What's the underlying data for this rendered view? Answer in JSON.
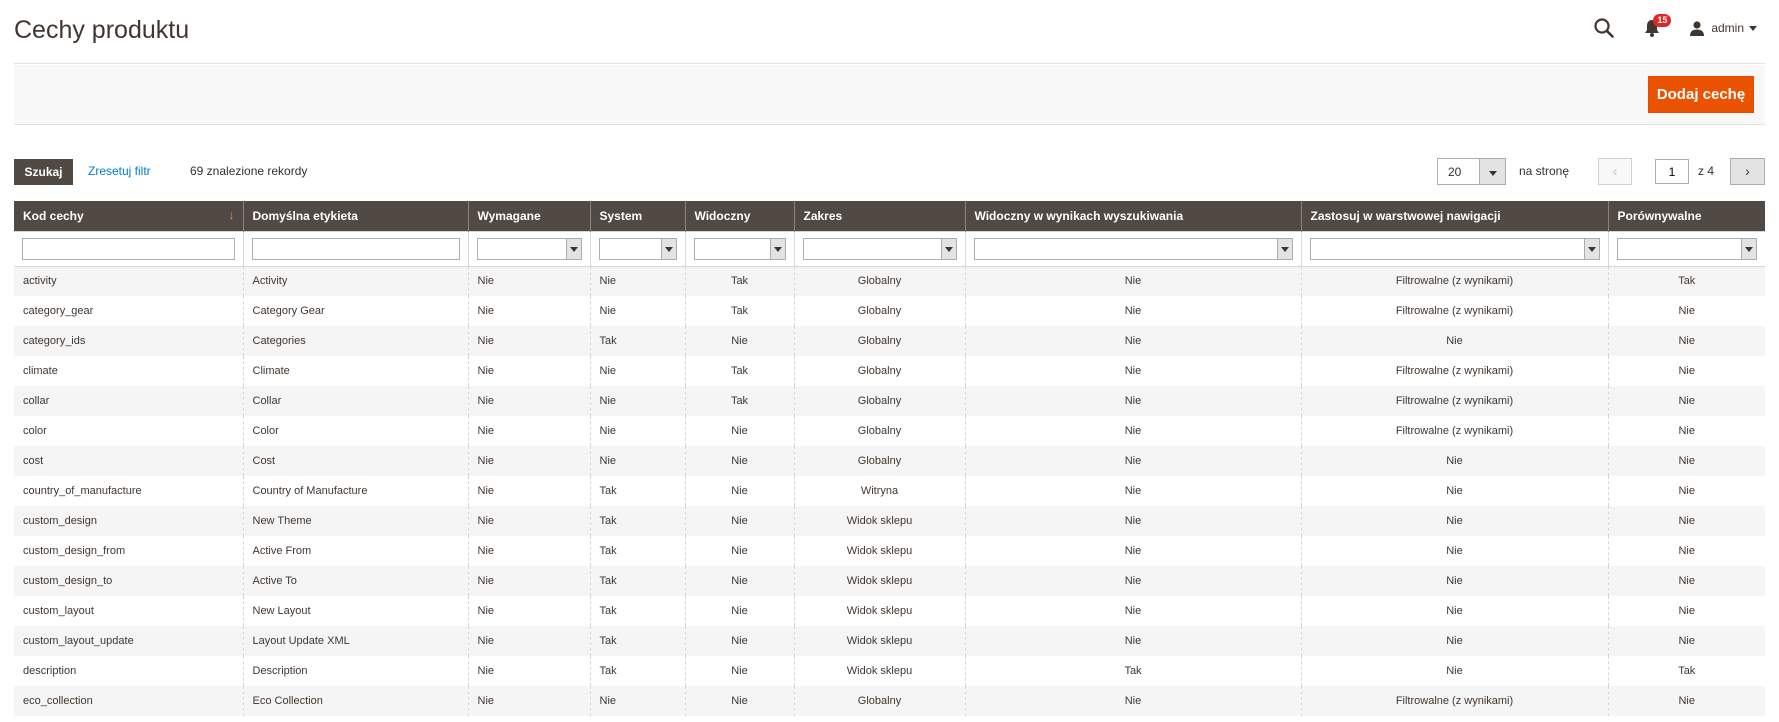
{
  "header": {
    "title": "Cechy produktu",
    "notifications_count": "15",
    "user_name": "admin"
  },
  "actions": {
    "add_label": "Dodaj cechę"
  },
  "toolbar": {
    "search_label": "Szukaj",
    "reset_label": "Zresetuj filtr",
    "records_text": "69 znalezione rekordy",
    "per_page_value": "20",
    "per_page_label": "na stronę",
    "current_page": "1",
    "total_pages_text": "z 4"
  },
  "table": {
    "columns": [
      "Kod cechy",
      "Domyślna etykieta",
      "Wymagane",
      "System",
      "Widoczny",
      "Zakres",
      "Widoczny w wynikach wyszukiwania",
      "Zastosuj w warstwowej nawigacji",
      "Porównywalne"
    ],
    "rows": [
      [
        "activity",
        "Activity",
        "Nie",
        "Nie",
        "Tak",
        "Globalny",
        "Nie",
        "Filtrowalne (z wynikami)",
        "Tak"
      ],
      [
        "category_gear",
        "Category Gear",
        "Nie",
        "Nie",
        "Tak",
        "Globalny",
        "Nie",
        "Filtrowalne (z wynikami)",
        "Nie"
      ],
      [
        "category_ids",
        "Categories",
        "Nie",
        "Tak",
        "Nie",
        "Globalny",
        "Nie",
        "Nie",
        "Nie"
      ],
      [
        "climate",
        "Climate",
        "Nie",
        "Nie",
        "Tak",
        "Globalny",
        "Nie",
        "Filtrowalne (z wynikami)",
        "Nie"
      ],
      [
        "collar",
        "Collar",
        "Nie",
        "Nie",
        "Tak",
        "Globalny",
        "Nie",
        "Filtrowalne (z wynikami)",
        "Nie"
      ],
      [
        "color",
        "Color",
        "Nie",
        "Nie",
        "Nie",
        "Globalny",
        "Nie",
        "Filtrowalne (z wynikami)",
        "Nie"
      ],
      [
        "cost",
        "Cost",
        "Nie",
        "Nie",
        "Nie",
        "Globalny",
        "Nie",
        "Nie",
        "Nie"
      ],
      [
        "country_of_manufacture",
        "Country of Manufacture",
        "Nie",
        "Tak",
        "Nie",
        "Witryna",
        "Nie",
        "Nie",
        "Nie"
      ],
      [
        "custom_design",
        "New Theme",
        "Nie",
        "Tak",
        "Nie",
        "Widok sklepu",
        "Nie",
        "Nie",
        "Nie"
      ],
      [
        "custom_design_from",
        "Active From",
        "Nie",
        "Tak",
        "Nie",
        "Widok sklepu",
        "Nie",
        "Nie",
        "Nie"
      ],
      [
        "custom_design_to",
        "Active To",
        "Nie",
        "Tak",
        "Nie",
        "Widok sklepu",
        "Nie",
        "Nie",
        "Nie"
      ],
      [
        "custom_layout",
        "New Layout",
        "Nie",
        "Tak",
        "Nie",
        "Widok sklepu",
        "Nie",
        "Nie",
        "Nie"
      ],
      [
        "custom_layout_update",
        "Layout Update XML",
        "Nie",
        "Tak",
        "Nie",
        "Widok sklepu",
        "Nie",
        "Nie",
        "Nie"
      ],
      [
        "description",
        "Description",
        "Nie",
        "Tak",
        "Nie",
        "Widok sklepu",
        "Tak",
        "Nie",
        "Tak"
      ],
      [
        "eco_collection",
        "Eco Collection",
        "Nie",
        "Nie",
        "Nie",
        "Globalny",
        "Nie",
        "Filtrowalne (z wynikami)",
        "Nie"
      ]
    ]
  },
  "icons": {
    "search": "search-icon",
    "notifications": "bell-icon",
    "user": "user-icon",
    "sort": "sort-arrow-icon",
    "prev": "chevron-left-icon",
    "next": "chevron-right-icon"
  },
  "colors": {
    "accent": "#eb5202",
    "header_bg": "#514943",
    "link": "#007bdb",
    "badge": "#e22626"
  }
}
